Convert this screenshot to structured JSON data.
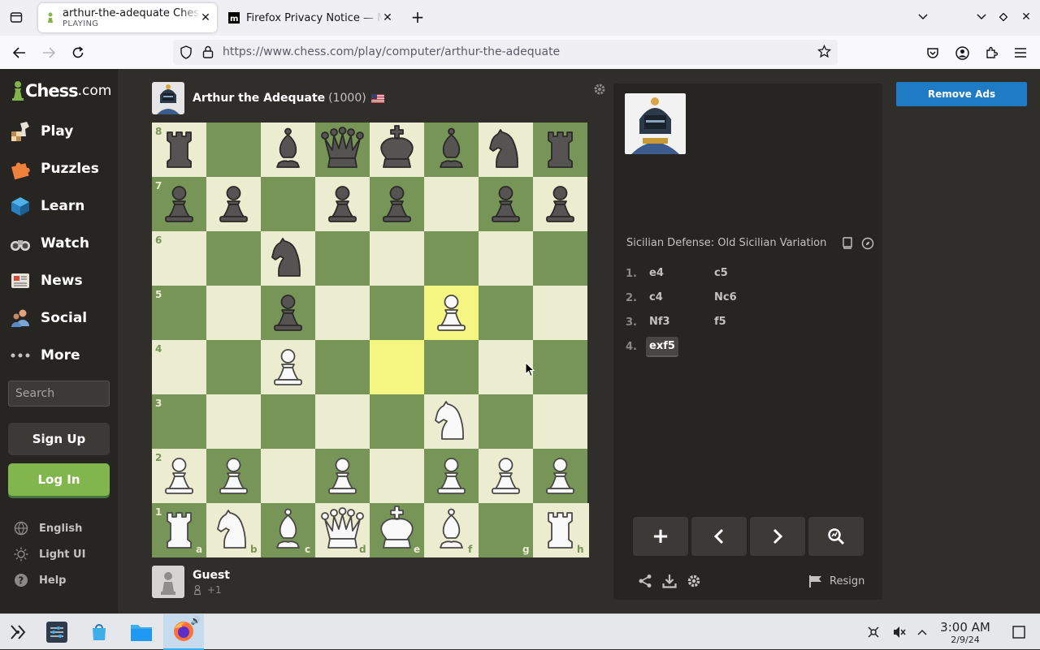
{
  "browser": {
    "tabs": [
      {
        "title": "arthur-the-adequate Chess",
        "subtitle": "PLAYING",
        "icon": "chess-pawn-icon",
        "active": true
      },
      {
        "title": "Firefox Privacy Notice — M",
        "icon": "mozilla-icon",
        "active": false
      }
    ],
    "url_host": "https://www.chess.com",
    "url_path": "/play/computer/arthur-the-adequate"
  },
  "sidebar": {
    "logo_main": "Chess",
    "logo_suffix": ".com",
    "items": [
      {
        "label": "Play",
        "icon": "play-board-icon"
      },
      {
        "label": "Puzzles",
        "icon": "puzzle-piece-icon"
      },
      {
        "label": "Learn",
        "icon": "learn-cube-icon"
      },
      {
        "label": "Watch",
        "icon": "binoculars-icon"
      },
      {
        "label": "News",
        "icon": "newspaper-icon"
      },
      {
        "label": "Social",
        "icon": "people-icon"
      },
      {
        "label": "More",
        "icon": "more-dots-icon"
      }
    ],
    "search_placeholder": "Search",
    "signup_label": "Sign Up",
    "login_label": "Log In",
    "footer": [
      {
        "label": "English",
        "icon": "globe-icon"
      },
      {
        "label": "Light UI",
        "icon": "sun-icon"
      },
      {
        "label": "Help",
        "icon": "help-icon"
      }
    ]
  },
  "top_player": {
    "name": "Arthur the Adequate",
    "rating": "(1000)",
    "flag": "us-flag-icon"
  },
  "bottom_player": {
    "name": "Guest",
    "score": "+1"
  },
  "board": {
    "ranks": [
      "8",
      "7",
      "6",
      "5",
      "4",
      "3",
      "2",
      "1"
    ],
    "files": [
      "a",
      "b",
      "c",
      "d",
      "e",
      "f",
      "g",
      "h"
    ],
    "highlight_squares": [
      "f5",
      "e4"
    ],
    "position": [
      [
        "br",
        "",
        "bb",
        "bq",
        "bk",
        "bb",
        "bn",
        "br"
      ],
      [
        "bp",
        "bp",
        "",
        "bp",
        "bp",
        "",
        "bp",
        "bp"
      ],
      [
        "",
        "",
        "bn",
        "",
        "",
        "",
        "",
        ""
      ],
      [
        "",
        "",
        "bp",
        "",
        "",
        "wp",
        "",
        ""
      ],
      [
        "",
        "",
        "wp",
        "",
        "",
        "",
        "",
        ""
      ],
      [
        "",
        "",
        "",
        "",
        "",
        "wn",
        "",
        ""
      ],
      [
        "wp",
        "wp",
        "",
        "wp",
        "",
        "wp",
        "wp",
        "wp"
      ],
      [
        "wr",
        "wn",
        "wb",
        "wq",
        "wk",
        "wb",
        "",
        "wr"
      ]
    ]
  },
  "panel": {
    "opening": "Sicilian Defense: Old Sicilian Variation",
    "moves": [
      {
        "num": "1.",
        "white": "e4",
        "black": "c5"
      },
      {
        "num": "2.",
        "white": "c4",
        "black": "Nc6"
      },
      {
        "num": "3.",
        "white": "Nf3",
        "black": "f5"
      },
      {
        "num": "4.",
        "white": "exf5",
        "black": ""
      }
    ],
    "resign_label": "Resign"
  },
  "remove_ads_label": "Remove Ads",
  "taskbar": {
    "time": "3:00 AM",
    "date": "2/9/24"
  }
}
